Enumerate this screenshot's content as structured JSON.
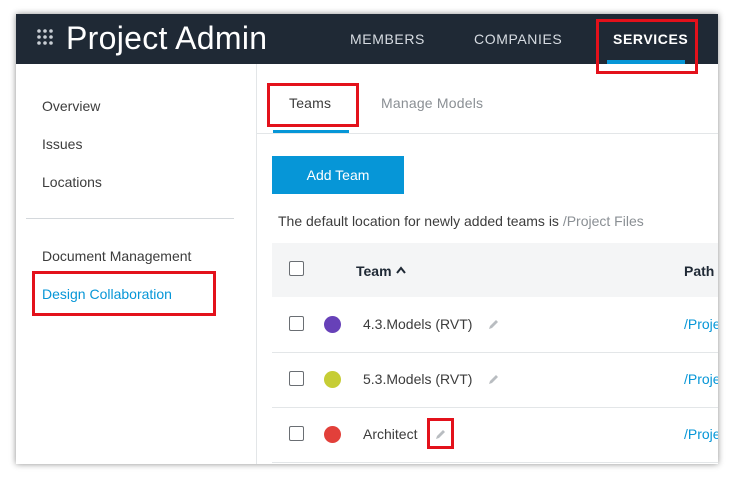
{
  "header": {
    "app_title": "Project Admin",
    "nav": [
      {
        "label": "MEMBERS"
      },
      {
        "label": "COMPANIES"
      },
      {
        "label": "SERVICES",
        "active": true
      }
    ]
  },
  "sidebar": {
    "items": [
      {
        "label": "Overview"
      },
      {
        "label": "Issues"
      },
      {
        "label": "Locations"
      },
      {
        "label": "Document Management"
      },
      {
        "label": "Design Collaboration",
        "active": true
      }
    ]
  },
  "tabs": [
    {
      "label": "Teams",
      "active": true
    },
    {
      "label": "Manage Models"
    }
  ],
  "add_team_label": "Add Team",
  "info": {
    "prefix": "The default location for newly added teams is",
    "path": "/Project Files"
  },
  "table": {
    "columns": {
      "team": "Team",
      "path": "Path"
    },
    "rows": [
      {
        "name": "4.3.Models (RVT)",
        "color": "#6741b8",
        "path": "/Proje"
      },
      {
        "name": "5.3.Models (RVT)",
        "color": "#c6cd35",
        "path": "/Proje"
      },
      {
        "name": "Architect",
        "color": "#e2403a",
        "path": "/Proje"
      }
    ]
  },
  "colors": {
    "header_bg": "#1f2935",
    "accent": "#0696d7",
    "highlight": "#e3111b"
  },
  "icons": [
    "grid-menu-icon",
    "sort-ascending-icon",
    "pencil-icon"
  ]
}
